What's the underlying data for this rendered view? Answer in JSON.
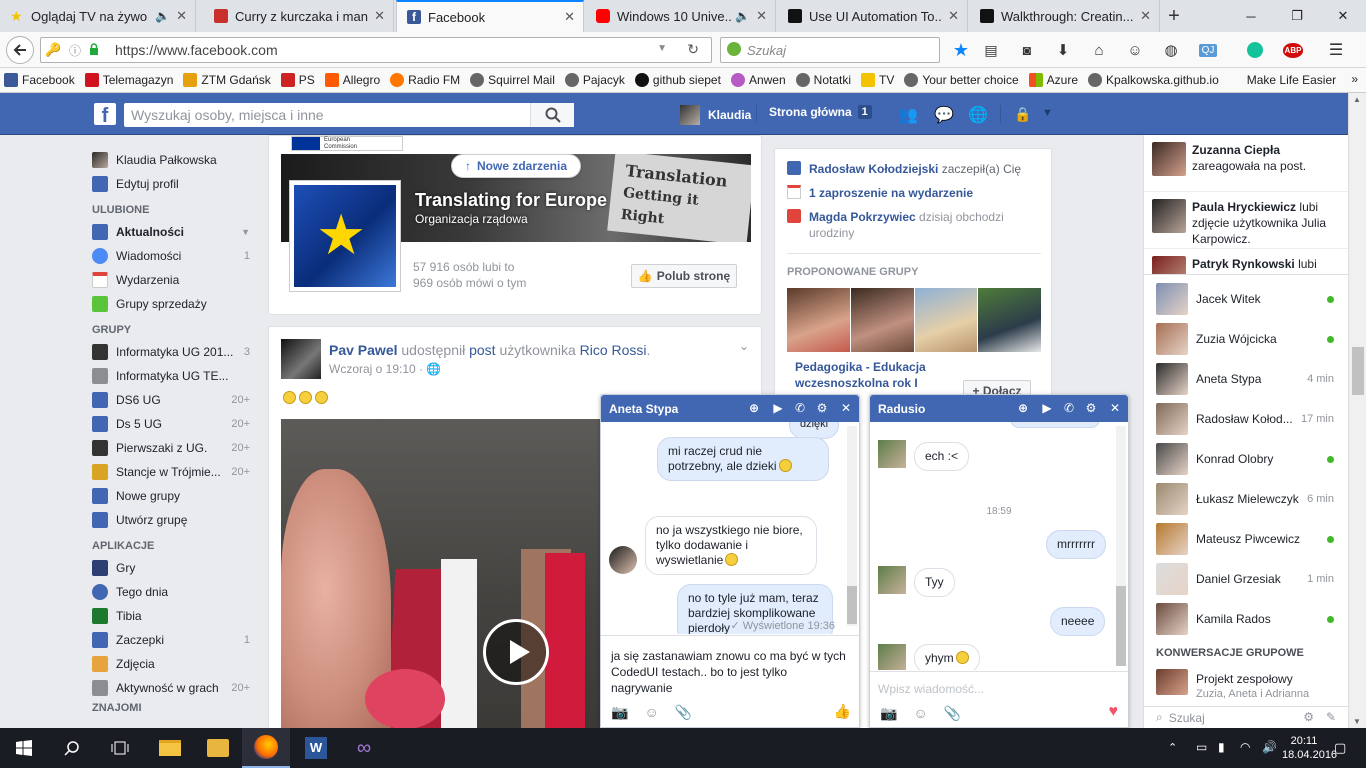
{
  "browser": {
    "tabs": [
      {
        "title": "Oglądaj TV na żywo",
        "icon_color": "#f3c300"
      },
      {
        "title": "Curry z kurczaka i man...",
        "icon_color": "#c9302c"
      },
      {
        "title": "Facebook",
        "icon_color": "#3b5998"
      },
      {
        "title": "Windows 10 Unive...",
        "icon_color": "#ff0000"
      },
      {
        "title": "Use UI Automation To...",
        "icon_color": "#111111"
      },
      {
        "title": "Walkthrough: Creatin...",
        "icon_color": "#111111"
      }
    ],
    "new_tab": "+",
    "url": "https://www.facebook.com",
    "search_placeholder": "Szukaj",
    "bookmarks": [
      {
        "label": "Facebook",
        "color": "#3b5998"
      },
      {
        "label": "Telemagazyn",
        "color": "#d0121f"
      },
      {
        "label": "ZTM Gdańsk",
        "color": "#e5a00d"
      },
      {
        "label": "PS",
        "color": "#cc2222"
      },
      {
        "label": "Allegro",
        "color": "#ff5a00"
      },
      {
        "label": "Radio FM",
        "color": "#ff7700"
      },
      {
        "label": "Squirrel Mail",
        "color": "#666666"
      },
      {
        "label": "Pajacyk",
        "color": "#666666"
      },
      {
        "label": "github siepet",
        "color": "#111111"
      },
      {
        "label": "Anwen",
        "color": "#b65ac6"
      },
      {
        "label": "Notatki",
        "color": "#666666"
      },
      {
        "label": "TV",
        "color": "#f3c300"
      },
      {
        "label": "Your better choice",
        "color": "#666666"
      },
      {
        "label": "Azure",
        "color": "#0078d7"
      },
      {
        "label": "Kpalkowska.github.io",
        "color": "#666666"
      },
      {
        "label": "Make Life Easier",
        "color": "#f9f9fa"
      }
    ],
    "abp_badge": "ABP"
  },
  "fb": {
    "search_placeholder": "Wyszukaj osoby, miejsca i inne",
    "user_name": "Klaudia",
    "home_label": "Strona główna",
    "home_count": "1"
  },
  "left": {
    "profile": [
      {
        "label": "Klaudia Pałkowska",
        "count": "",
        "color": "#6b5a4e"
      },
      {
        "label": "Edytuj profil",
        "count": "",
        "color": "#4267b2"
      }
    ],
    "favorites_title": "ULUBIONE",
    "favorites": [
      {
        "label": "Aktualności",
        "count": "",
        "color": "#4267b2"
      },
      {
        "label": "Wiadomości",
        "count": "1",
        "color": "#4c8bf5"
      },
      {
        "label": "Wydarzenia",
        "count": "",
        "color": "#e0443b"
      },
      {
        "label": "Grupy sprzedaży",
        "count": "",
        "color": "#5ac43a"
      }
    ],
    "groups_title": "GRUPY",
    "groups": [
      {
        "label": "Informatyka UG 201...",
        "count": "3",
        "color": "#333333"
      },
      {
        "label": "Informatyka UG TE...",
        "count": "",
        "color": "#8a8d91"
      },
      {
        "label": "DS6 UG",
        "count": "20+",
        "color": "#4267b2"
      },
      {
        "label": "Ds 5 UG",
        "count": "20+",
        "color": "#4267b2"
      },
      {
        "label": "Pierwszaki z UG.",
        "count": "20+",
        "color": "#333333"
      },
      {
        "label": "Stancje w Trójmie...",
        "count": "20+",
        "color": "#d9a323"
      },
      {
        "label": "Nowe grupy",
        "count": "",
        "color": "#4267b2"
      },
      {
        "label": "Utwórz grupę",
        "count": "",
        "color": "#4267b2"
      }
    ],
    "apps_title": "APLIKACJE",
    "apps": [
      {
        "label": "Gry",
        "count": "",
        "color": "#2c3e74"
      },
      {
        "label": "Tego dnia",
        "count": "",
        "color": "#4267b2"
      },
      {
        "label": "Tibia",
        "count": "",
        "color": "#1d7a2d"
      },
      {
        "label": "Zaczepki",
        "count": "1",
        "color": "#4267b2"
      },
      {
        "label": "Zdjęcia",
        "count": "",
        "color": "#e7a33e"
      },
      {
        "label": "Aktywność w grach",
        "count": "20+",
        "color": "#8a8d91"
      }
    ],
    "friends_title": "ZNAJOMI"
  },
  "page_card": {
    "new_stories": "Nowe zdarzenia",
    "name": "Translating for Europe",
    "category": "Organizacja rządowa",
    "likes": "57 916 osób lubi to",
    "talking": "969 osób mówi o tym",
    "like_button": "Polub stronę",
    "cover_sign_line1": "Translation",
    "cover_sign_line2": "Getting it Right",
    "commission_label": "European Commission"
  },
  "post": {
    "author": "Pav Pawel",
    "shared": "udostępnił",
    "post_word": "post",
    "user_of": "użytkownika",
    "original_author": "Rico Rossi",
    "time": "Wczoraj o 19:10",
    "emoji_count": 3
  },
  "right": {
    "notifications": [
      {
        "bold": "Radosław Kołodziejski",
        "text": " zaczepił(a) Cię",
        "color": "#4267b2"
      },
      {
        "bold": "1 zaproszenie na wydarzenie",
        "text": "",
        "color": "#e0443b"
      },
      {
        "bold": "Magda Pokrzywiec",
        "text": " dzisiaj obchodzi urodziny",
        "color": "#e0443b"
      }
    ],
    "groups_title": "PROPONOWANE GRUPY",
    "group_name": "Pedagogika - Edukacja wczesnoszkolna rok I",
    "join_label": "+ Dołącz"
  },
  "ticker": [
    {
      "name": "Zuzanna Ciepła",
      "text": "zareagowała na post."
    },
    {
      "name": "Paula Hryckiewicz",
      "text": "lubi zdjęcie użytkownika Julia Karpowicz."
    },
    {
      "name": "Patryk Rynkowski",
      "text": "lubi"
    }
  ],
  "chat_friends": [
    {
      "name": "Jacek Witek",
      "status": "online",
      "mins": ""
    },
    {
      "name": "Zuzia Wójcicka",
      "status": "online",
      "mins": ""
    },
    {
      "name": "Aneta Stypa",
      "status": "mins",
      "mins": "4 min"
    },
    {
      "name": "Radosław Kołod...",
      "status": "mins",
      "mins": "17 min"
    },
    {
      "name": "Konrad Olobry",
      "status": "online",
      "mins": ""
    },
    {
      "name": "Łukasz Mielewczyk",
      "status": "mins",
      "mins": "6 min"
    },
    {
      "name": "Mateusz Piwcewicz",
      "status": "online",
      "mins": ""
    },
    {
      "name": "Daniel Grzesiak",
      "status": "mins",
      "mins": "1 min"
    },
    {
      "name": "Kamila Rados",
      "status": "online",
      "mins": ""
    }
  ],
  "group_convos_title": "KONWERSACJE GRUPOWE",
  "group_convo": {
    "name": "Projekt zespołowy",
    "sub": "Zuzia, Aneta i Adrianna"
  },
  "chat_search_placeholder": "Szukaj",
  "chat1": {
    "name": "Aneta Stypa",
    "msgs": [
      {
        "from": "me",
        "text": "dzięki"
      },
      {
        "from": "me",
        "text": "mi raczej crud nie potrzebny, ale dzieki"
      },
      {
        "from": "them",
        "text": "no ja wszystkiego nie biore, tylko dodawanie i wyswietlanie"
      },
      {
        "from": "me",
        "text": "no to tyle już mam, teraz bardziej skomplikowane pierdoły"
      }
    ],
    "seen": "Wyświetlone 19:36",
    "draft": "ja się zastanawiam znowu co ma być w tych CodedUI testach.. bo to jest tylko nagrywanie"
  },
  "chat2": {
    "name": "Radusio",
    "msgs": [
      {
        "from": "them",
        "text": "ech :<"
      },
      {
        "from": "time",
        "text": "18:59"
      },
      {
        "from": "me",
        "text": "mrrrrrrr"
      },
      {
        "from": "them",
        "text": "Tyy"
      },
      {
        "from": "me",
        "text": "neeee"
      },
      {
        "from": "them",
        "text": "yhym"
      }
    ],
    "placeholder": "Wpisz wiadomość..."
  },
  "taskbar": {
    "time": "20:11",
    "date": "18.04.2016"
  }
}
